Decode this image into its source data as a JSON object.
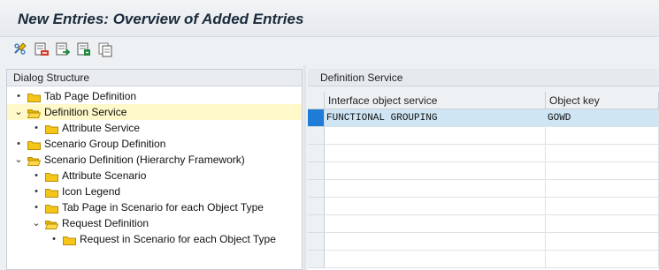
{
  "window": {
    "title": "New Entries: Overview of Added Entries"
  },
  "toolbar": {
    "buttons": [
      {
        "icon": "display-change-icon"
      },
      {
        "icon": "delete-entry-icon"
      },
      {
        "icon": "previous-entry-icon"
      },
      {
        "icon": "next-entry-icon"
      },
      {
        "icon": "copy-entry-icon"
      }
    ]
  },
  "dialog_structure": {
    "header": "Dialog Structure",
    "items": [
      {
        "label": "Tab Page Definition",
        "level": 0,
        "control": "•",
        "open": false,
        "selected": false
      },
      {
        "label": "Definition Service",
        "level": 0,
        "control": "⌄",
        "open": true,
        "selected": true
      },
      {
        "label": "Attribute Service",
        "level": 1,
        "control": "•",
        "open": false,
        "selected": false
      },
      {
        "label": "Scenario Group Definition",
        "level": 0,
        "control": "•",
        "open": false,
        "selected": false
      },
      {
        "label": "Scenario Definition (Hierarchy Framework)",
        "level": 0,
        "control": "⌄",
        "open": true,
        "selected": false
      },
      {
        "label": "Attribute Scenario",
        "level": 1,
        "control": "•",
        "open": false,
        "selected": false
      },
      {
        "label": "Icon Legend",
        "level": 1,
        "control": "•",
        "open": false,
        "selected": false
      },
      {
        "label": "Tab Page in Scenario for each Object Type",
        "level": 1,
        "control": "•",
        "open": false,
        "selected": false
      },
      {
        "label": "Request Definition",
        "level": 1,
        "control": "⌄",
        "open": true,
        "selected": false
      },
      {
        "label": "Request in Scenario for each Object Type",
        "level": 2,
        "control": "•",
        "open": false,
        "selected": false
      }
    ]
  },
  "definition_service": {
    "header": "Definition Service",
    "columns": [
      "Interface object service",
      "Object key"
    ],
    "rows": [
      [
        "FUNCTIONAL GROUPING",
        "GOWD"
      ],
      [
        "",
        ""
      ],
      [
        "",
        ""
      ],
      [
        "",
        ""
      ],
      [
        "",
        ""
      ],
      [
        "",
        ""
      ],
      [
        "",
        ""
      ],
      [
        "",
        ""
      ],
      [
        "",
        ""
      ]
    ]
  },
  "colors": {
    "selected_tree_row": "#fff8c8",
    "selected_grid_row": "#cfe5f4",
    "row_selector_active": "#1e7bd6",
    "folder": "#f5c518"
  }
}
